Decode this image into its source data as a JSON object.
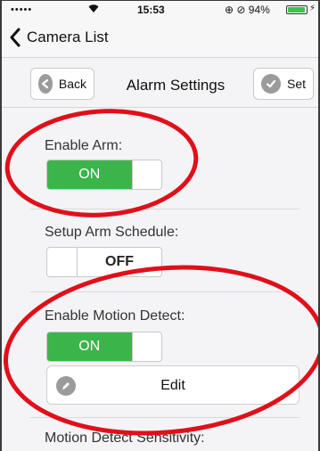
{
  "status_bar": {
    "signal": "•••••",
    "wifi_icon": "wifi-icon",
    "time": "15:53",
    "indicators": "⊕ ⊘ 94%",
    "battery_percent": 94,
    "battery_color": "#39c64b"
  },
  "nav": {
    "back_label": "Camera List",
    "back_icon": "chevron-left-icon"
  },
  "toolbar": {
    "back_label": "Back",
    "title": "Alarm Settings",
    "set_label": "Set"
  },
  "settings": {
    "enable_arm": {
      "label": "Enable Arm:",
      "state": "ON"
    },
    "arm_schedule": {
      "label": "Setup Arm Schedule:",
      "state": "OFF"
    },
    "motion_detect": {
      "label": "Enable Motion Detect:",
      "state": "ON",
      "edit_label": "Edit"
    },
    "sensitivity": {
      "label": "Motion Detect Sensitivity:"
    }
  },
  "colors": {
    "switch_on": "#3bb54a",
    "annotation": "#e0101a"
  }
}
